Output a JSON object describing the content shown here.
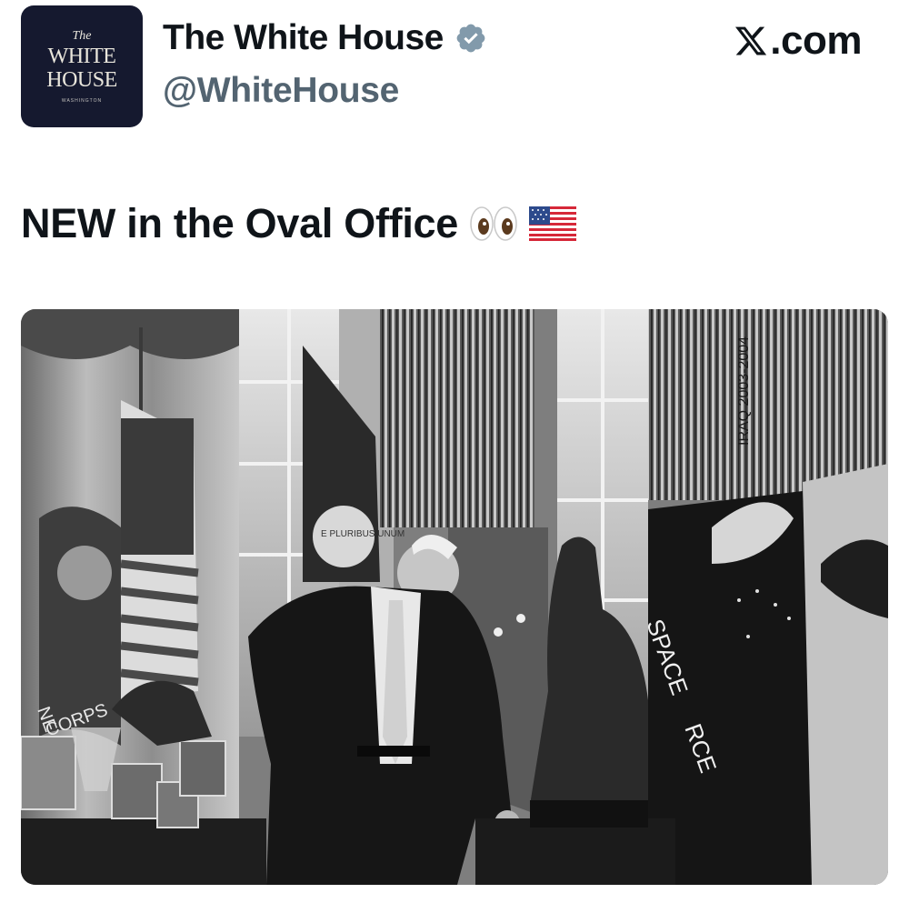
{
  "account": {
    "avatar": {
      "line1": "The",
      "line2": "WHITE",
      "line3": "HOUSE",
      "line4": "WASHINGTON",
      "bg_color": "#15192f"
    },
    "display_name": "The White House",
    "verified_badge": "verified-badge-icon",
    "badge_color": "#829aab",
    "handle": "@WhiteHouse"
  },
  "site": {
    "logo": "x-logo-icon",
    "label": ".com"
  },
  "tweet": {
    "text": "NEW in the Oval Office",
    "emojis": [
      "eyes-emoji",
      "us-flag-emoji"
    ]
  },
  "photo": {
    "alt_subject": "man-at-desk-with-statue",
    "flag_texts": {
      "space_force_1": "SPACE",
      "space_force_2": "RCE",
      "marine_corps": "CORPS",
      "marine_ne": "NE",
      "eagle_motto": "E PLURIBUS UNUM",
      "streamer": "IRAQ 2003-2004"
    }
  }
}
